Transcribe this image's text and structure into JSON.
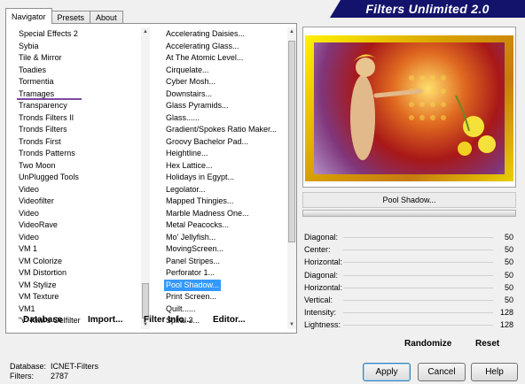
{
  "tabs": [
    "Navigator",
    "Presets",
    "About"
  ],
  "banner_title": "Filters Unlimited 2.0",
  "categories": [
    "Special Effects 2",
    "Sybia",
    "Tile & Mirror",
    "Toadies",
    "Tormentia",
    "Tramages",
    "Transparency",
    "Tronds Filters II",
    "Tronds Filters",
    "Tronds First",
    "Tronds Patterns",
    "Two Moon",
    "UnPlugged Tools",
    "Video",
    "Videofilter",
    "Video",
    "VideoRave",
    "Video",
    "VM 1",
    "VM Colorize",
    "VM Distortion",
    "VM Stylize",
    "VM Texture",
    "VM1",
    "\"v\" Kiwi's Oelfilter"
  ],
  "filters": [
    "Accelerating Daisies...",
    "Accelerating Glass...",
    "At The Atomic Level...",
    "Cirquelate...",
    "Cyber Mosh...",
    "Downstairs...",
    "Glass Pyramids...",
    "Glass......",
    "Gradient/Spokes Ratio Maker...",
    "Groovy Bachelor Pad...",
    "Heightline...",
    "Hex Lattice...",
    "Holidays in Egypt...",
    "Legolator...",
    "Mapped Thingies...",
    "Marble Madness One...",
    "Metal Peacocks...",
    "Mo' Jellyfish...",
    "MovingScreen...",
    "Panel Stripes...",
    "Perforator 1...",
    "Pool Shadow...",
    "Print Screen...",
    "Quilt......",
    "Spiral 3..."
  ],
  "bottom_links": {
    "database": "Database",
    "import": "Import...",
    "filter_info": "Filter Info...",
    "editor": "Editor..."
  },
  "selected_filter": "Pool Shadow...",
  "params": [
    {
      "label": "Diagonal:",
      "value": "50"
    },
    {
      "label": "Center:",
      "value": "50"
    },
    {
      "label": "Horizontal:",
      "value": "50"
    },
    {
      "label": "Diagonal:",
      "value": "50"
    },
    {
      "label": "Horizontal:",
      "value": "50"
    },
    {
      "label": "Vertical:",
      "value": "50"
    },
    {
      "label": "Intensity:",
      "value": "128"
    },
    {
      "label": "Lightness:",
      "value": "128"
    }
  ],
  "randomize": "Randomize",
  "reset": "Reset",
  "db": {
    "db_label": "Database:",
    "db_value": "ICNET-Filters",
    "filters_label": "Filters:",
    "filters_value": "2787"
  },
  "buttons": {
    "apply": "Apply",
    "cancel": "Cancel",
    "help": "Help"
  },
  "colors": {
    "banner": "#13136b",
    "selection": "#3399ff",
    "underline": "#7b4aa0"
  }
}
